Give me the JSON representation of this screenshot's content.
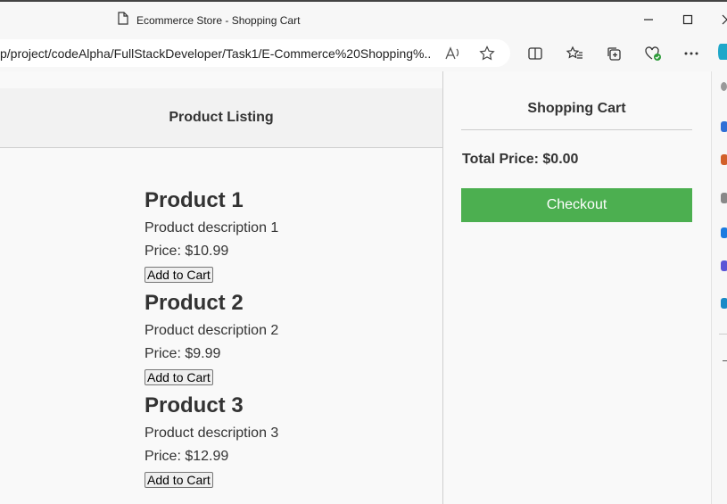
{
  "window": {
    "title": "Ecommerce Store - Shopping Cart"
  },
  "toolbar": {
    "url": "p/project/codeAlpha/FullStackDeveloper/Task1/E-Commerce%20Shopping%..."
  },
  "listing": {
    "heading": "Product Listing",
    "products": [
      {
        "name": "Product 1",
        "description": "Product description 1",
        "price": "Price: $10.99",
        "button": "Add to Cart"
      },
      {
        "name": "Product 2",
        "description": "Product description 2",
        "price": "Price: $9.99",
        "button": "Add to Cart"
      },
      {
        "name": "Product 3",
        "description": "Product description 3",
        "price": "Price: $12.99",
        "button": "Add to Cart"
      }
    ]
  },
  "cart": {
    "heading": "Shopping Cart",
    "total": "Total Price: $0.00",
    "checkout_label": "Checkout"
  },
  "colors": {
    "checkout": "#4caf50",
    "header_bg": "#f2f2f2"
  }
}
